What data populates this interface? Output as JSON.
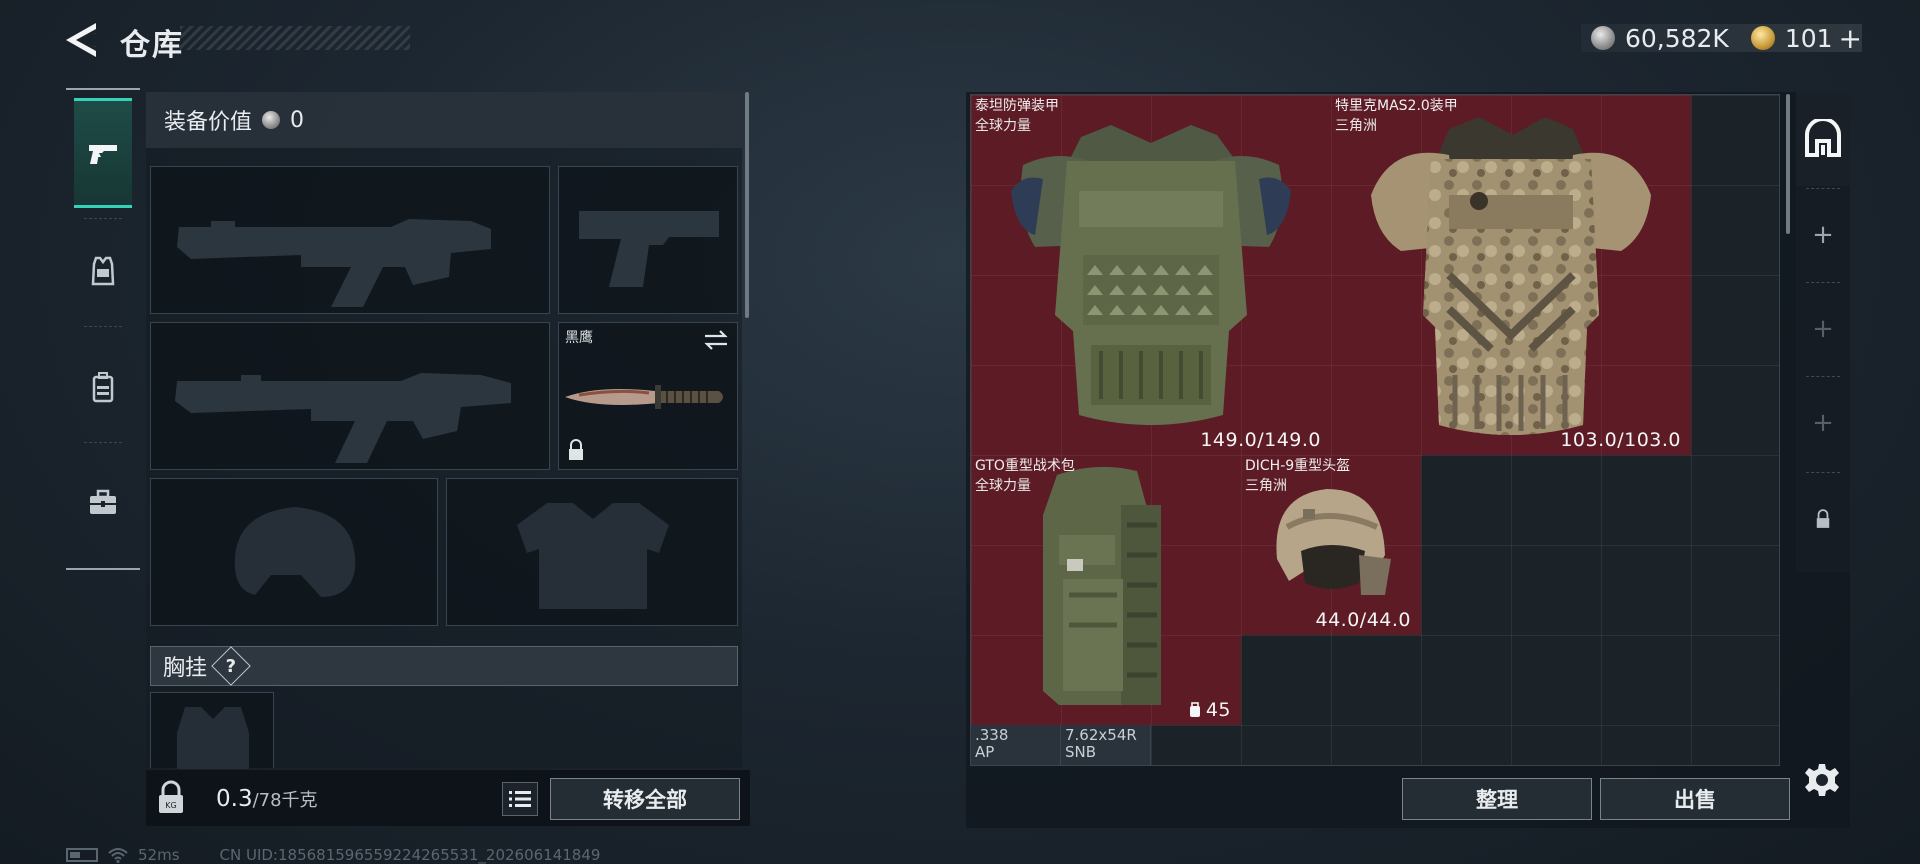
{
  "header": {
    "title": "仓库",
    "currency": [
      {
        "icon": "silver-coin-icon",
        "value": "60,582K"
      },
      {
        "icon": "gold-coin-icon",
        "value": "101"
      }
    ],
    "currency_add": "+"
  },
  "left_nav": {
    "tabs": [
      {
        "name": "weapons",
        "icon": "pistol-icon",
        "active": true
      },
      {
        "name": "gear",
        "icon": "vest-icon",
        "active": false
      },
      {
        "name": "backpack",
        "icon": "backpack-icon",
        "active": false
      },
      {
        "name": "kit",
        "icon": "briefcase-icon",
        "active": false
      }
    ]
  },
  "equipment": {
    "value_label": "装备价值",
    "value": "0",
    "slots": [
      {
        "name": "primary-weapon-1",
        "icon": "assault-rifle-silhouette",
        "empty": true
      },
      {
        "name": "sidearm",
        "icon": "pistol-silhouette",
        "empty": true
      },
      {
        "name": "primary-weapon-2",
        "icon": "rifle-silhouette",
        "empty": true
      },
      {
        "name": "melee",
        "label": "黑鹰",
        "icon": "knife-icon",
        "empty": false,
        "locked": true
      },
      {
        "name": "helmet",
        "icon": "helmet-silhouette",
        "empty": true
      },
      {
        "name": "armor",
        "icon": "armor-silhouette",
        "empty": true
      }
    ],
    "chest_rig_label": "胸挂",
    "help": "?"
  },
  "weight": {
    "current": "0.3",
    "max": "/78千克"
  },
  "buttons": {
    "transfer_all": "转移全部",
    "sort": "整理",
    "sell": "出售"
  },
  "stash": {
    "items": [
      {
        "name": "泰坦防弹装甲",
        "origin": "全球力量",
        "value": "149.0/149.0"
      },
      {
        "name": "特里克MAS2.0装甲",
        "origin": "三角洲",
        "value": "103.0/103.0"
      },
      {
        "name": "GTO重型战术包",
        "origin": "全球力量",
        "value": "45"
      },
      {
        "name": "DICH-9重型头盔",
        "origin": "三角洲",
        "value": "44.0/44.0"
      }
    ],
    "ammo": [
      {
        "line1": ".338",
        "line2": "AP"
      },
      {
        "line1": "7.62x54R",
        "line2": "SNB"
      }
    ]
  },
  "status": {
    "ping": "52ms",
    "uid": "CN UID:185681596559224265531_202606141849"
  },
  "colors": {
    "accent": "#35d2b8",
    "item_bg": "#5c1b25",
    "panel": "#1b2228"
  }
}
